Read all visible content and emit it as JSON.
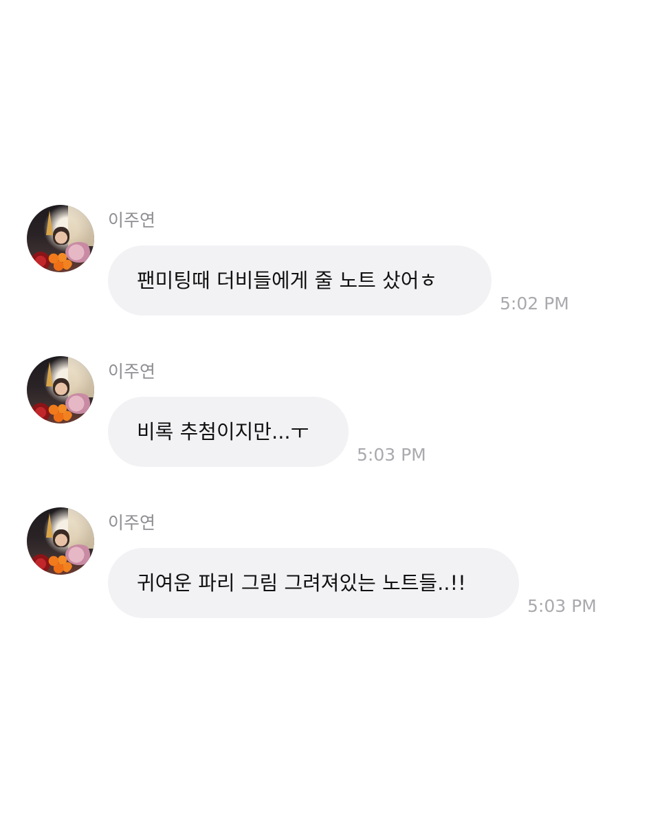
{
  "messages": [
    {
      "sender": "이주연",
      "text": "팬미팅때 더비들에게 줄 노트 샀어ㅎ",
      "time": "5:02 PM"
    },
    {
      "sender": "이주연",
      "text": "비록 추첨이지만...ㅜ",
      "time": "5:03 PM"
    },
    {
      "sender": "이주연",
      "text": "귀여운 파리 그림 그려져있는 노트들..!!",
      "time": "5:03 PM"
    }
  ],
  "colors": {
    "background": "#ffffff",
    "bubble": "#f2f2f5",
    "sender_name": "#8e8e93",
    "timestamp": "#a9a9ae",
    "message_text": "#111111"
  },
  "icons": {
    "avatar": "profile-photo-avatar"
  }
}
